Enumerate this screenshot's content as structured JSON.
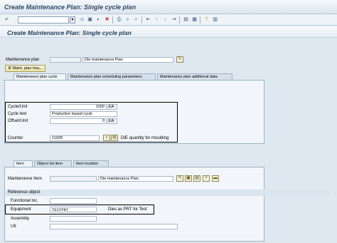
{
  "window_title": "Create Maintenance Plan: Single cycle plan",
  "page_heading": "Create Maintenance Plan: Single cycle plan",
  "toolbar_icons": [
    "ok-icon",
    "back-icon",
    "exit-icon",
    "cancel-icon",
    "print-icon",
    "find-icon",
    "find-next-icon",
    "first-page-icon",
    "prev-page-icon",
    "next-page-icon",
    "last-page-icon",
    "new-session-icon",
    "shortcut-icon",
    "help-icon",
    "customize-icon"
  ],
  "header": {
    "maint_plan_label": "Maintenance plan",
    "maint_plan_value": "",
    "maint_plan_text": "Die maintenance Plan",
    "header_button_label": "Maint. plan hea..."
  },
  "tabs_top": {
    "cycle": "Maintenance plan cycle",
    "scheduling": "Maintenance plan scheduling parameters",
    "additional": "Maintenance plan additional data"
  },
  "cycle": {
    "cycle_unit_label": "Cycle/Unit",
    "cycle_value": "1000",
    "cycle_unit": "EA",
    "cycle_text_label": "Cycle text",
    "cycle_text_value": "Production based cycle",
    "offset_label": "Offset/Unit",
    "offset_value": "0",
    "offset_unit": "EA",
    "counter_label": "Counter",
    "counter_value": "11928",
    "counter_text": "DIE quantity for moulding"
  },
  "tabs_bottom": {
    "item": "Item",
    "object_list": "Object list item",
    "location": "Item location"
  },
  "item": {
    "label": "Maintenance Item",
    "value": "",
    "text": "Die maintenance Plan"
  },
  "reference": {
    "title": "Reference object",
    "func_loc_label": "Functional loc.",
    "func_loc_value": "",
    "equipment_label": "Equipment",
    "equipment_value": "TESTPRT",
    "equipment_text": "Dies as PRT for Test",
    "assembly_label": "Assembly",
    "assembly_value": "",
    "uii_label": "UII",
    "uii_value": ""
  },
  "colors": {
    "background": "#dfe8f1",
    "highlight_box": "#000000"
  }
}
